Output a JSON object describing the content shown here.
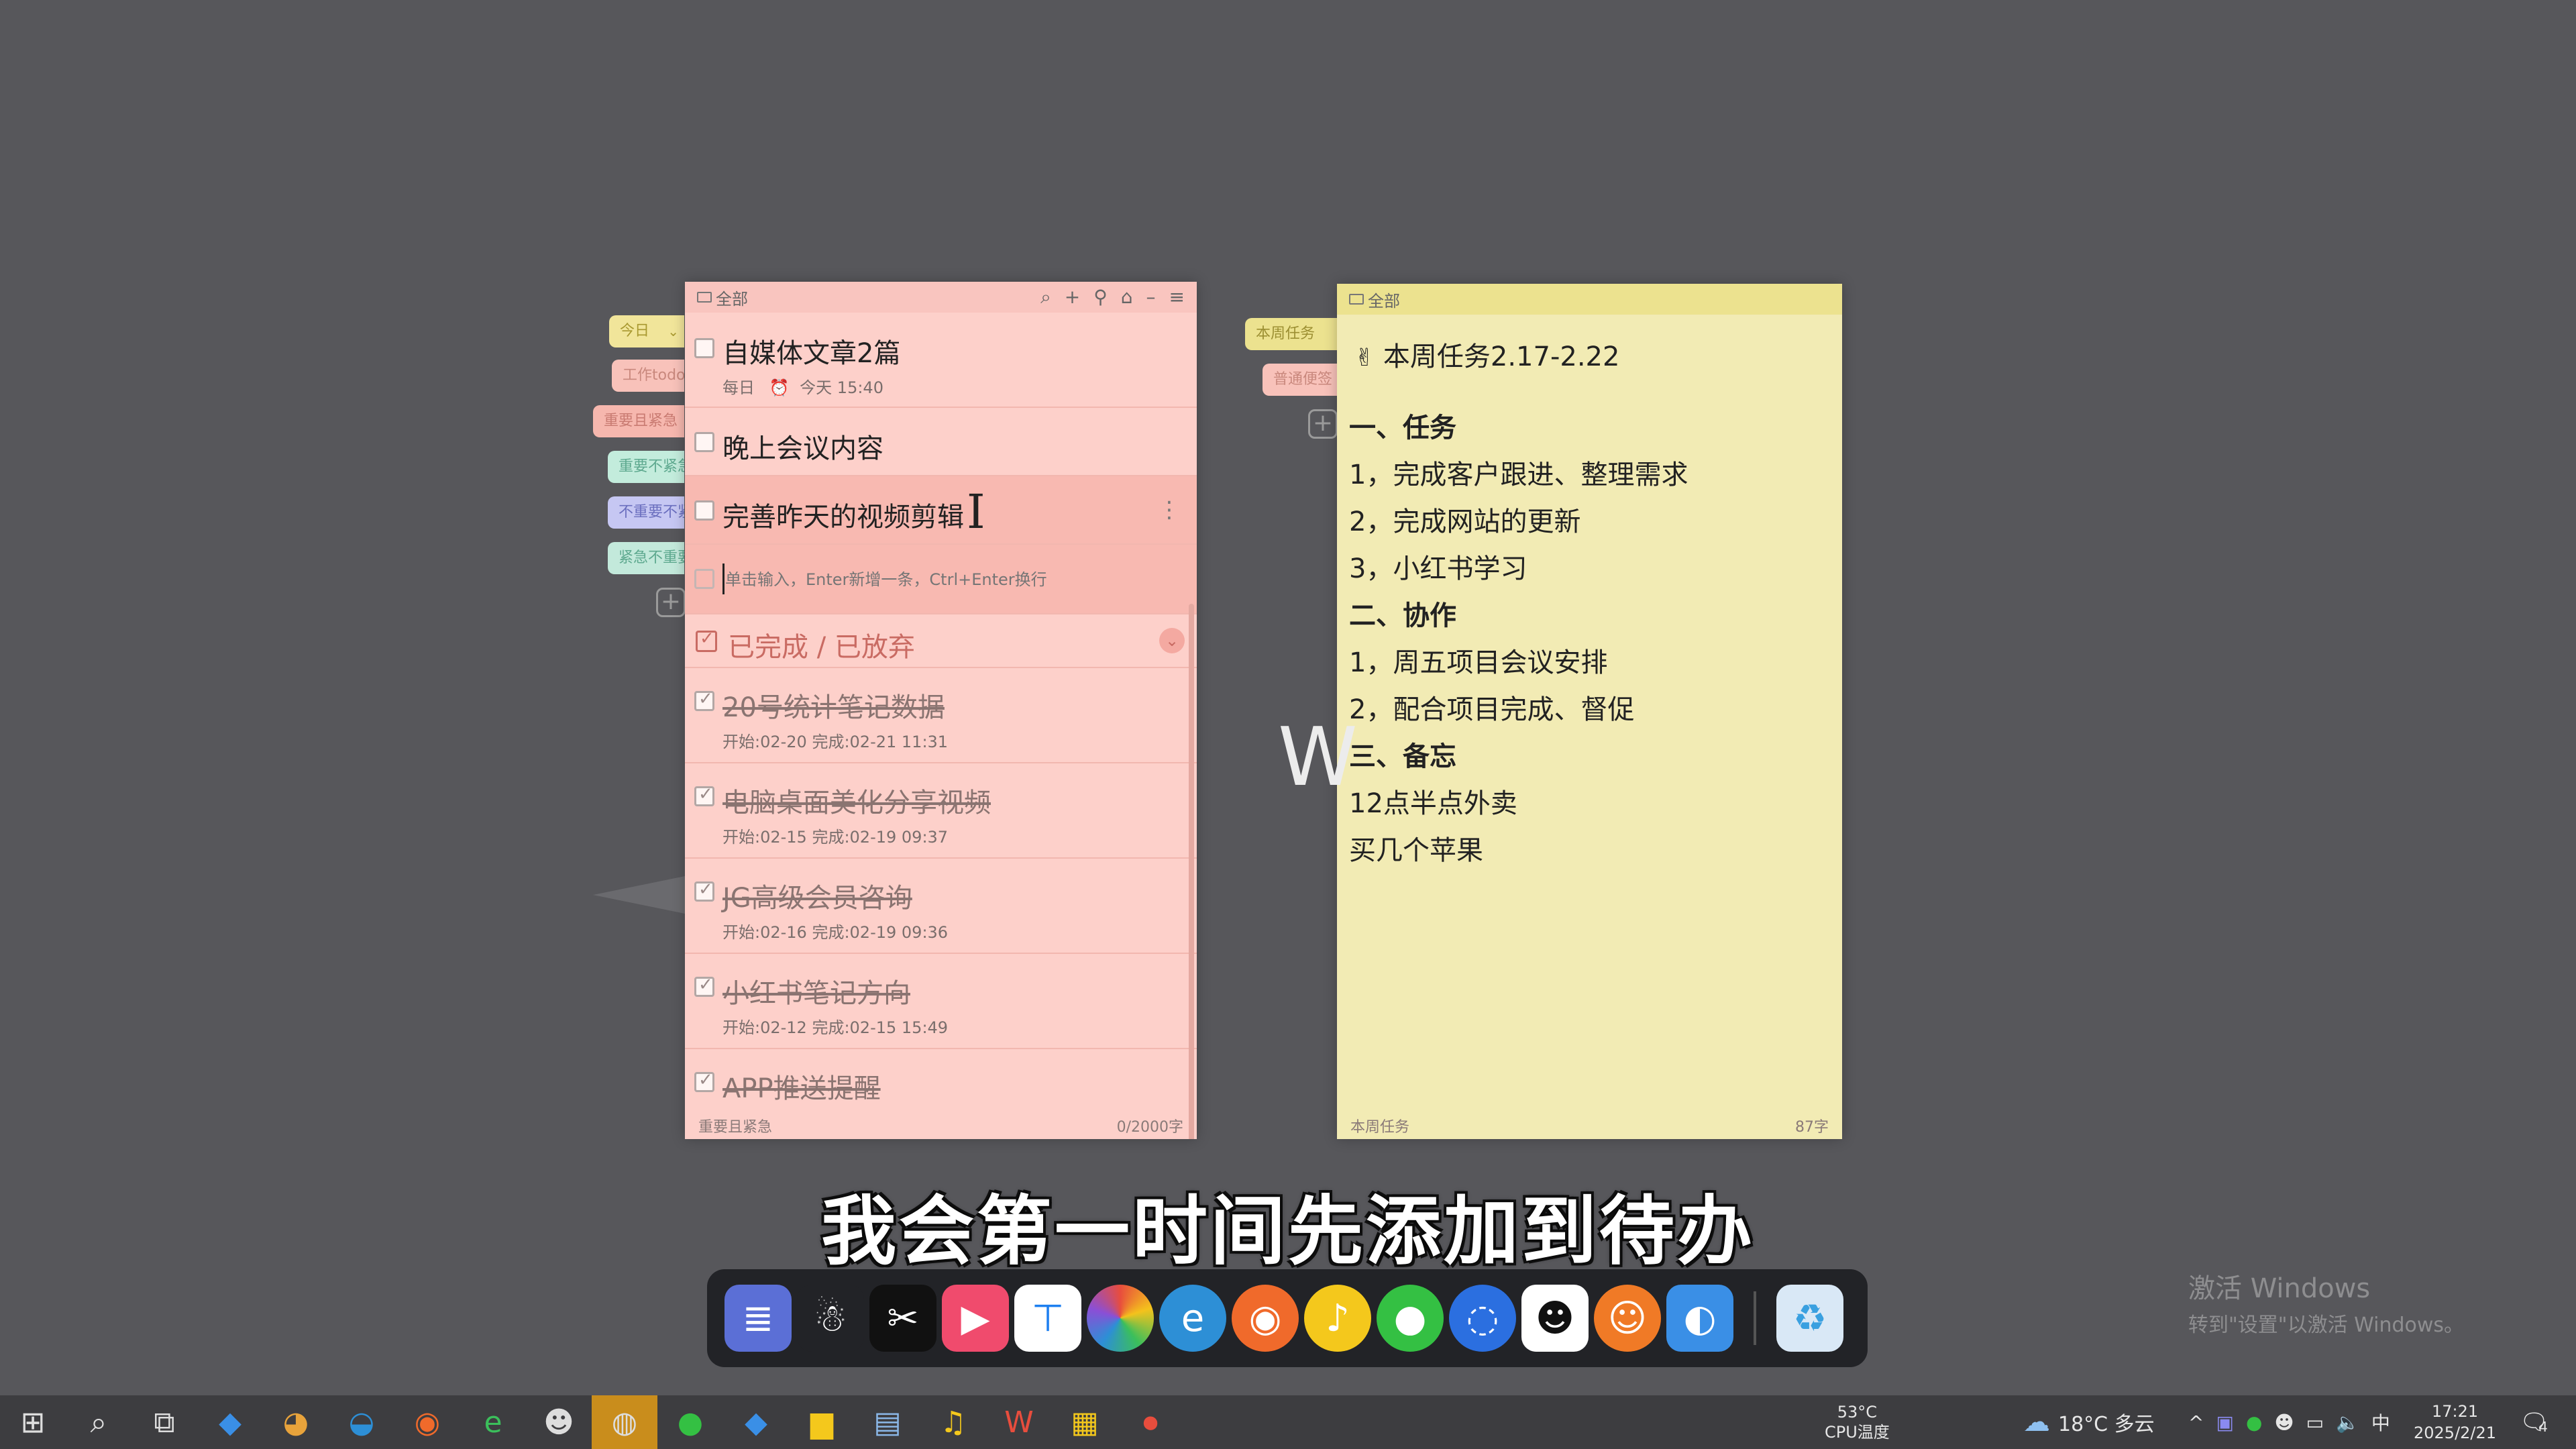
{
  "side_tabs": {
    "left": [
      "今日",
      "工作todo",
      "重要且紧急",
      "重要不紧急",
      "不重要不紧急",
      "紧急不重要"
    ],
    "right": [
      "本周任务",
      "普通便签"
    ]
  },
  "todo": {
    "title": "全部",
    "tasks": [
      {
        "title": "自媒体文章2篇",
        "repeat": "每日",
        "due": "今天 15:40"
      },
      {
        "title": "晚上会议内容"
      },
      {
        "title": "完善昨天的视频剪辑"
      }
    ],
    "input_placeholder": "单击输入，Enter新增一条，Ctrl+Enter换行",
    "completed_header": "已完成 / 已放弃",
    "done_tasks": [
      {
        "title": "20号统计笔记数据",
        "meta": "开始:02-20  完成:02-21 11:31"
      },
      {
        "title": "电脑桌面美化分享视频",
        "meta": "开始:02-15  完成:02-19 09:37"
      },
      {
        "title": "JG高级会员咨询",
        "meta": "开始:02-16  完成:02-19 09:36"
      },
      {
        "title": "小红书笔记方向",
        "meta": "开始:02-12  完成:02-15 15:49"
      },
      {
        "title": "APP推送提醒",
        "meta": ""
      }
    ],
    "footer_left": "重要且紧急",
    "footer_right": "0/2000字"
  },
  "note": {
    "title": "全部",
    "heading": "本周任务2.17-2.22",
    "lines": [
      {
        "text": "一、任务",
        "bold": true
      },
      {
        "text": "1，完成客户跟进、整理需求"
      },
      {
        "text": "2，完成网站的更新"
      },
      {
        "text": "3，小红书学习"
      },
      {
        "text": "二、协作",
        "bold": true
      },
      {
        "text": "1，周五项目会议安排"
      },
      {
        "text": "2，配合项目完成、督促"
      },
      {
        "text": "三、备忘",
        "bold": true
      },
      {
        "text": "12点半点外卖"
      },
      {
        "text": "买几个苹果"
      }
    ],
    "footer_left": "本周任务",
    "footer_right": "87字"
  },
  "overlay": {
    "subtitle": "我会第一时间先添加到待办",
    "w_mark": "W",
    "activate_title": "激活 Windows",
    "activate_sub": "转到\"设置\"以激活 Windows。"
  },
  "dock": {
    "apps": [
      {
        "icon": "notes-icon",
        "color": "#5b6fd6"
      },
      {
        "icon": "mascot-icon",
        "color": "#222327"
      },
      {
        "icon": "capcut-icon",
        "color": "#111111"
      },
      {
        "icon": "video-editor-icon",
        "color": "#f04b6d"
      },
      {
        "icon": "tencent-meeting-icon",
        "color": "#ffffff"
      },
      {
        "icon": "color-picker-icon",
        "color": "#e8a33b"
      },
      {
        "icon": "edge-icon",
        "color": "#2d8fd6"
      },
      {
        "icon": "firefox-icon",
        "color": "#f06a2b"
      },
      {
        "icon": "music-icon",
        "color": "#f4c81c"
      },
      {
        "icon": "wechat-icon",
        "color": "#34c043"
      },
      {
        "icon": "chat-bubble-icon",
        "color": "#2b6fe0"
      },
      {
        "icon": "qq-icon",
        "color": "#ffffff"
      },
      {
        "icon": "raccoon-icon",
        "color": "#f07a26"
      },
      {
        "icon": "finder-icon",
        "color": "#3a8fe6"
      },
      {
        "icon": "recycle-bin-icon",
        "color": "#d9e8f6"
      }
    ]
  },
  "taskbar": {
    "cpu_temp": "53°C",
    "cpu_label": "CPU温度",
    "weather": "18°C 多云",
    "ime": "中",
    "time": "17:21",
    "date": "2025/2/21",
    "notifications": "4"
  }
}
